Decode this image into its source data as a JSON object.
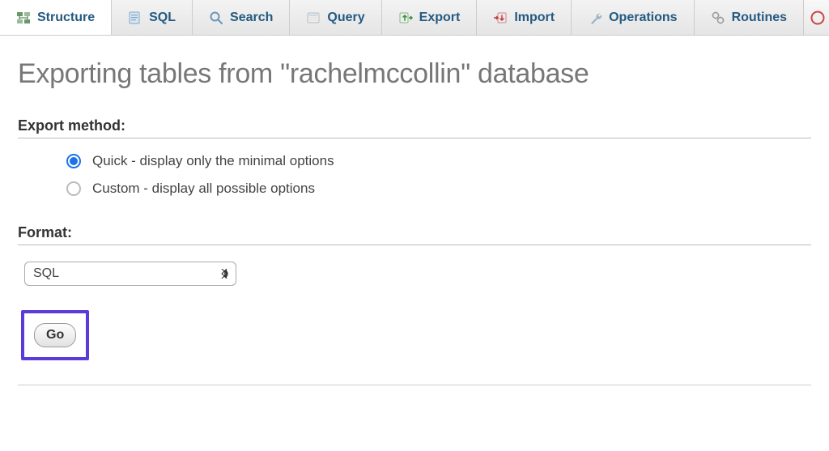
{
  "tabs": [
    {
      "label": "Structure",
      "icon": "structure-icon",
      "active": true
    },
    {
      "label": "SQL",
      "icon": "sql-icon"
    },
    {
      "label": "Search",
      "icon": "search-icon"
    },
    {
      "label": "Query",
      "icon": "query-icon"
    },
    {
      "label": "Export",
      "icon": "export-icon"
    },
    {
      "label": "Import",
      "icon": "import-icon"
    },
    {
      "label": "Operations",
      "icon": "operations-icon"
    },
    {
      "label": "Routines",
      "icon": "routines-icon"
    }
  ],
  "page_title": "Exporting tables from \"rachelmccollin\" database",
  "sections": {
    "export_method_label": "Export method:",
    "format_label": "Format:"
  },
  "export_methods": [
    {
      "label": "Quick - display only the minimal options",
      "checked": true
    },
    {
      "label": "Custom - display all possible options",
      "checked": false
    }
  ],
  "format_selected": "SQL",
  "go_label": "Go"
}
